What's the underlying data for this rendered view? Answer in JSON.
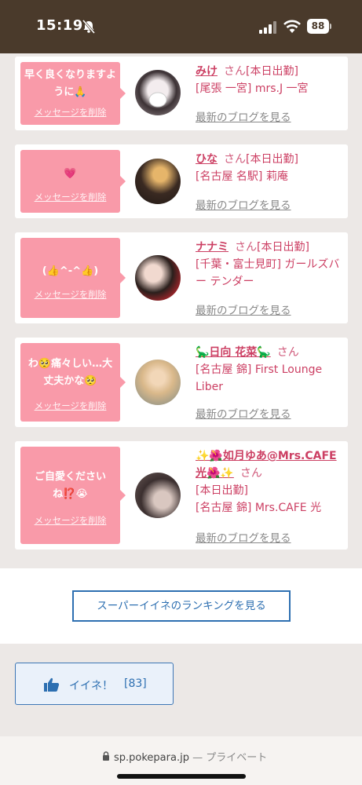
{
  "status_bar": {
    "time": "15:19",
    "battery": "88"
  },
  "cards": [
    {
      "message": "早く良くなりますように🙏",
      "delete_label": "メッセージを削除",
      "name": "みけ",
      "honorific": "さん",
      "status": "[本日出勤]",
      "shop": "[尾張 一宮] mrs.J 一宮",
      "blog_link": "最新のブログを見る"
    },
    {
      "message": "💗",
      "delete_label": "メッセージを削除",
      "name": "ひな",
      "honorific": "さん",
      "status": "[本日出勤]",
      "shop": "[名古屋 名駅] 莉庵",
      "blog_link": "最新のブログを見る"
    },
    {
      "message": "(👍^-^👍)",
      "delete_label": "メッセージを削除",
      "name": "ナナミ",
      "honorific": "さん",
      "status": "[本日出勤]",
      "shop": "[千葉・富士見町] ガールズバー テンダー",
      "blog_link": "最新のブログを見る"
    },
    {
      "message": "わ🥺痛々しい…大丈夫かな🥺",
      "delete_label": "メッセージを削除",
      "name": "🦕日向 花菜🦕",
      "honorific": "さん",
      "status": "",
      "shop": "[名古屋 錦] First Lounge Liber",
      "blog_link": "最新のブログを見る"
    },
    {
      "message": "ご自愛くださいね⁉️😭",
      "delete_label": "メッセージを削除",
      "name": "✨🌺如月ゆあ@Mrs.CAFE光🌺✨",
      "honorific": "さん",
      "status": "[本日出勤]",
      "shop": "[名古屋 錦] Mrs.CAFE 光",
      "blog_link": "最新のブログを見る"
    }
  ],
  "ranking_button": "スーパーイイネのランキングを見る",
  "like_button": {
    "label": "イイネ！",
    "count": "[83]"
  },
  "url_bar": {
    "domain": "sp.pokepara.jp",
    "separator": "—",
    "mode": "プライベート"
  },
  "colors": {
    "status_bar": "#4a3a2b",
    "bubble": "#f99aa9",
    "name": "#cc3f63",
    "link_blue": "#2d6fb1"
  },
  "icons": [
    "bell-slash-icon",
    "signal-icon",
    "wifi-icon",
    "battery-icon",
    "thumbs-up-icon",
    "lock-icon"
  ]
}
